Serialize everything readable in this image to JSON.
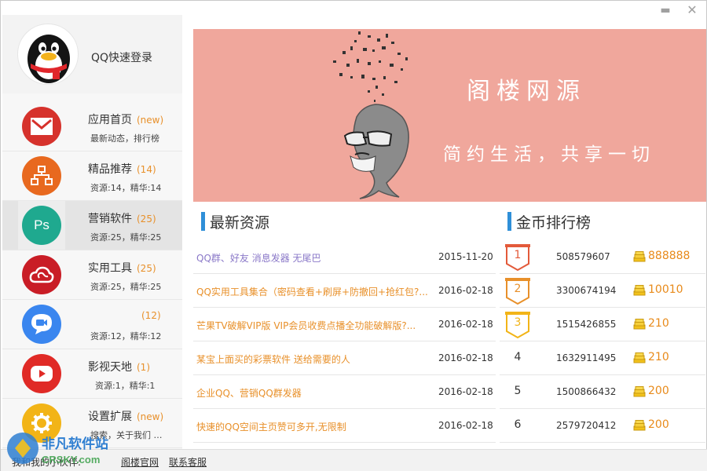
{
  "window": {
    "minimize": "▬",
    "close": "✕"
  },
  "profile": {
    "login_label": "QQ快速登录",
    "avatar_icon": "qq-penguin-icon"
  },
  "nav": [
    {
      "title": "应用首页",
      "badge": "(new)",
      "sub": "最新动态，排行榜",
      "icon": "gmail-envelope-icon",
      "color": "#d6322c"
    },
    {
      "title": "精品推荐",
      "badge": "(14)",
      "sub": "资源:14，精华:14",
      "icon": "sitemap-icon",
      "color": "#e8691f"
    },
    {
      "title": "营销软件",
      "badge": "(25)",
      "sub": "资源:25，精华:25",
      "icon": "photoshop-icon",
      "color": "#1fa98f",
      "icon_text": "Ps"
    },
    {
      "title": "实用工具",
      "badge": "(25)",
      "sub": "资源:25，精华:25",
      "icon": "creative-cloud-icon",
      "color": "#c91d26"
    },
    {
      "title": "",
      "badge": "(12)",
      "sub": "资源:12，精华:12",
      "icon": "video-camera-icon",
      "color": "#3a86ef"
    },
    {
      "title": "影视天地",
      "badge": "(1)",
      "sub": "资源:1，精华:1",
      "icon": "youtube-play-icon",
      "color": "#e02a26"
    },
    {
      "title": "设置扩展",
      "badge": "(new)",
      "sub": "搜索，关于我们 …",
      "icon": "gear-icon",
      "color": "#f2b417"
    }
  ],
  "banner": {
    "title": "阁楼网源",
    "slogan": "简约生活，共享一切"
  },
  "latest": {
    "heading": "最新资源",
    "items": [
      {
        "title": "QQ群、好友 消息发器 无尾巴",
        "date": "2015-11-20",
        "color": "#8a78c8"
      },
      {
        "title": "QQ实用工具集合（密码查看+刷屏+防撤回+抢红包?...",
        "date": "2016-02-18",
        "color": "#e8902a"
      },
      {
        "title": "芒果TV破解VIP版 VIP会员收费点播全功能破解版?...",
        "date": "2016-02-18",
        "color": "#e8902a"
      },
      {
        "title": "某宝上面买的彩票软件 送给需要的人",
        "date": "2016-02-18",
        "color": "#e8902a"
      },
      {
        "title": " 企业QQ、营销QQ群发器",
        "date": "2016-02-18",
        "color": "#e8902a"
      },
      {
        "title": "快速的QQ空间主页赞可多开,无限制",
        "date": "2016-02-18",
        "color": "#e8902a"
      }
    ]
  },
  "ranking": {
    "heading": "金币排行榜",
    "items": [
      {
        "rank": "1",
        "user": "508579607",
        "coins": "888888",
        "medal_color": "#e35a3a"
      },
      {
        "rank": "2",
        "user": "3300674194",
        "coins": "10010",
        "medal_color": "#e8902a"
      },
      {
        "rank": "3",
        "user": "1515426855",
        "coins": "210",
        "medal_color": "#f2b417"
      },
      {
        "rank": "4",
        "user": "1632911495",
        "coins": "210"
      },
      {
        "rank": "5",
        "user": "1500866432",
        "coins": "200"
      },
      {
        "rank": "6",
        "user": "2579720412",
        "coins": "200"
      }
    ]
  },
  "footer": {
    "prefix": "我和我的小伙伴:",
    "link_site": "阁楼官网",
    "link_support": "联系客服"
  },
  "watermark": {
    "brand": "非凡软件站",
    "domain": "CRSKY.com"
  }
}
